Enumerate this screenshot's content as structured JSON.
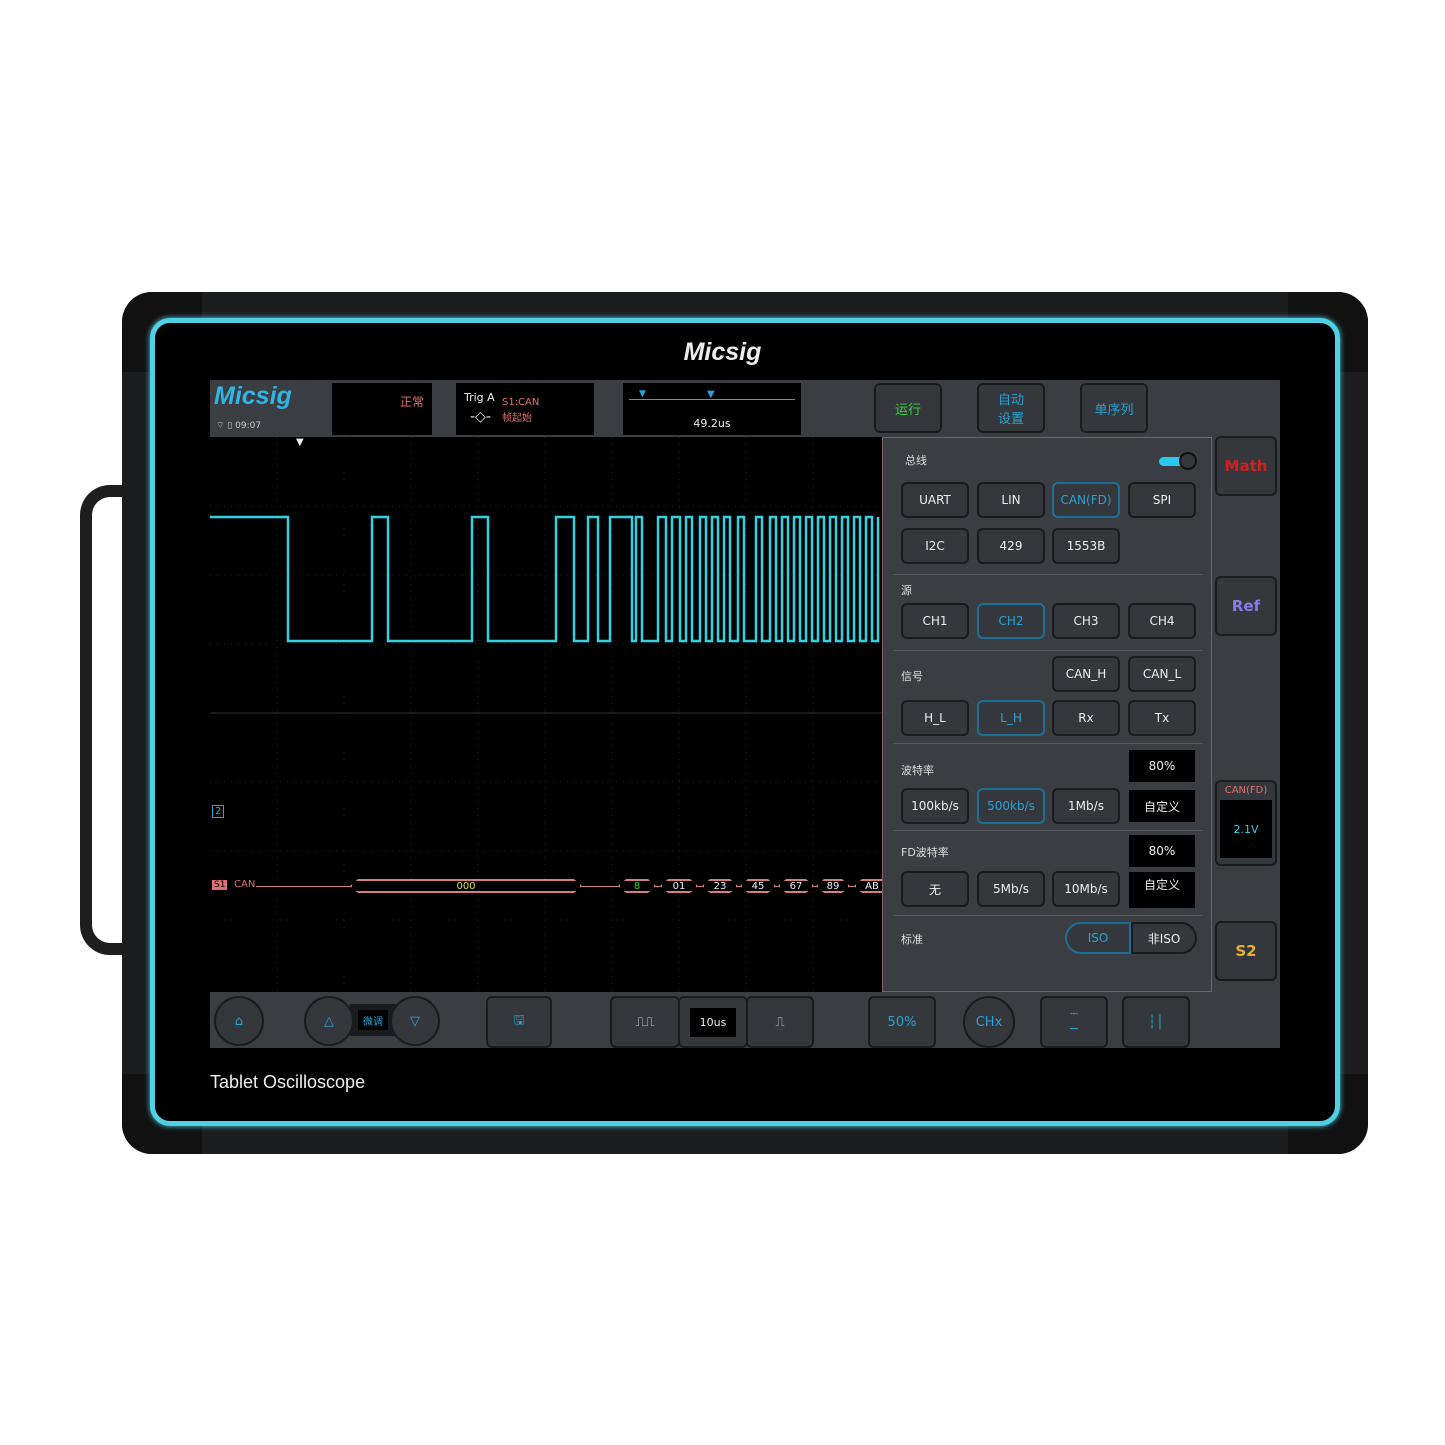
{
  "device": {
    "brand": "Micsig",
    "model": "Tablet Oscilloscope",
    "frame_color": "#4fd0e6"
  },
  "status": {
    "logo": "Micsig",
    "time": "09:07",
    "mode": "正常",
    "trigger_label": "Trig",
    "trigger_channel": "A",
    "trigger_source": "S1:CAN",
    "trigger_condition": "帧起始",
    "time_offset": "49.2us"
  },
  "top_buttons": {
    "run": "运行",
    "auto": "自动\n设置",
    "single": "单序列"
  },
  "waveform": {
    "channel_marker": "2",
    "trace_color": "#35d0e0"
  },
  "decode": {
    "marker": "S1",
    "label": "CAN",
    "fields": [
      "000",
      "8",
      "01",
      "23",
      "45",
      "67",
      "89",
      "AB"
    ]
  },
  "panel": {
    "bus_label": "总线",
    "bus_enabled": true,
    "bus_options": [
      "UART",
      "LIN",
      "CAN(FD)",
      "SPI",
      "I2C",
      "429",
      "1553B"
    ],
    "bus_selected": "CAN(FD)",
    "source_label": "源",
    "source_options": [
      "CH1",
      "CH2",
      "CH3",
      "CH4"
    ],
    "source_selected": "CH2",
    "signal_label": "信号",
    "signal_options": [
      "CAN_H",
      "CAN_L",
      "H_L",
      "L_H",
      "Rx",
      "Tx"
    ],
    "signal_selected": "L_H",
    "baud_label": "波特率",
    "baud_sample": "80%",
    "baud_options": [
      "100kb/s",
      "500kb/s",
      "1Mb/s"
    ],
    "baud_selected": "500kb/s",
    "baud_custom": "自定义",
    "fd_label": "FD波特率",
    "fd_sample": "80%",
    "fd_options": [
      "无",
      "5Mb/s",
      "10Mb/s"
    ],
    "fd_custom": "自定义",
    "standard_label": "标准",
    "standard_options": [
      "ISO",
      "非ISO"
    ],
    "standard_selected": "ISO"
  },
  "side": {
    "math": "Math",
    "ref": "Ref",
    "bus_title": "CAN(FD)",
    "bus_level": "2.1V",
    "s2": "S2"
  },
  "bottom": {
    "fine": "微调",
    "timebase": "10us",
    "trigger_level": "50%",
    "chx": "CHx"
  }
}
